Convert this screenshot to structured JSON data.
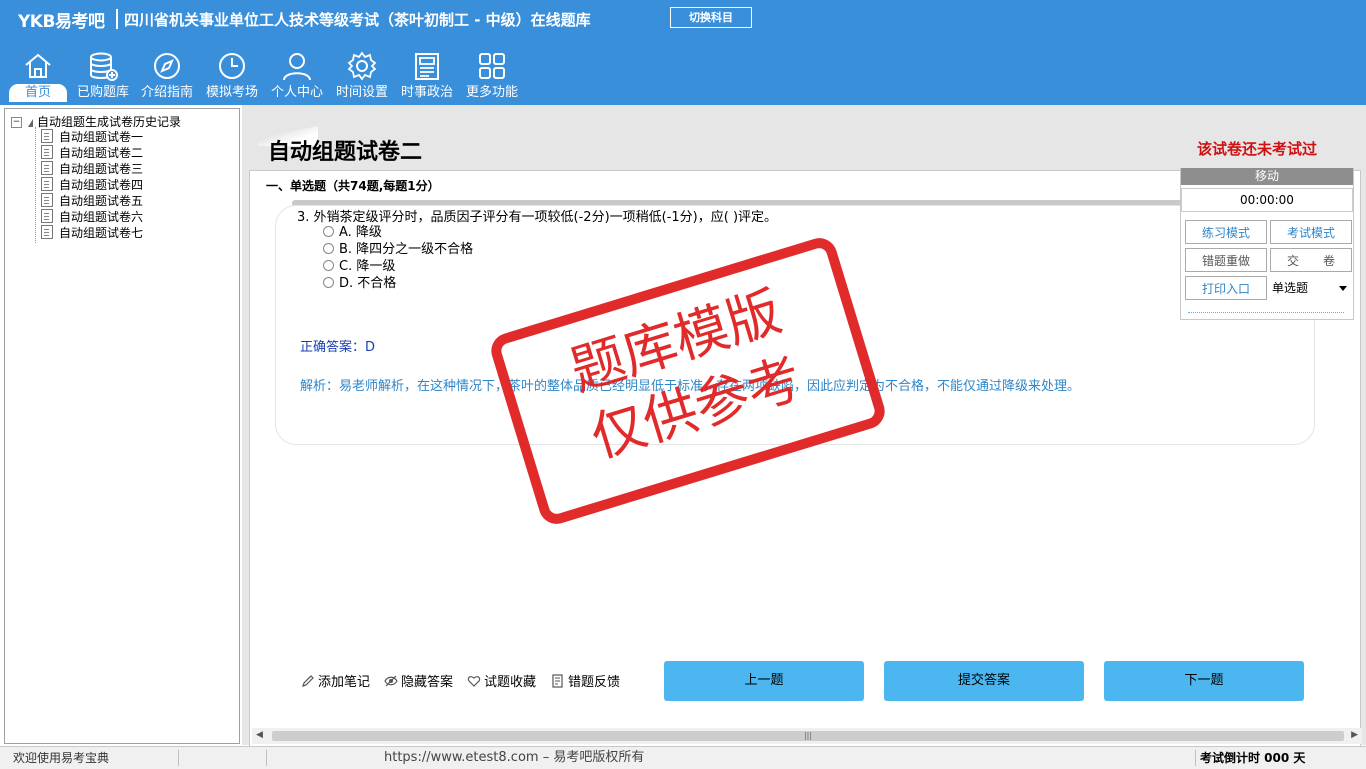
{
  "header": {
    "logo": "YKB易考吧",
    "title": "四川省机关事业单位工人技术等级考试（茶叶初制工 - 中级）在线题库",
    "switch_label": "切换科目",
    "nav": [
      {
        "label": "首页",
        "icon": "home-icon"
      },
      {
        "label": "已购题库",
        "icon": "database-icon"
      },
      {
        "label": "介绍指南",
        "icon": "compass-icon"
      },
      {
        "label": "模拟考场",
        "icon": "clock-icon"
      },
      {
        "label": "个人中心",
        "icon": "user-icon"
      },
      {
        "label": "时间设置",
        "icon": "gear-icon"
      },
      {
        "label": "时事政治",
        "icon": "news-icon"
      },
      {
        "label": "更多功能",
        "icon": "grid-icon"
      }
    ]
  },
  "tree": {
    "root": "自动组题生成试卷历史记录",
    "items": [
      "自动组题试卷一",
      "自动组题试卷二",
      "自动组题试卷三",
      "自动组题试卷四",
      "自动组题试卷五",
      "自动组题试卷六",
      "自动组题试卷七"
    ]
  },
  "main": {
    "doc_title": "自动组题试卷二",
    "exam_status": "该试卷还未考试过",
    "section_title": "一、单选题（共74题,每题1分）",
    "question": "3. 外销茶定级评分时，品质因子评分有一项较低(-2分)一项稍低(-1分)，应(  )评定。",
    "options": [
      "A. 降级",
      "B. 降四分之一级不合格",
      "C. 降一级",
      "D. 不合格"
    ],
    "answer": "正确答案：D",
    "analysis": "解析：易老师解析，在这种情况下，茶叶的整体品质已经明显低于标准，存在两项缺陷，因此应判定为不合格，不能仅通过降级来处理。",
    "stamp_line1": "题库模版",
    "stamp_line2": "仅供参考",
    "tools": [
      "添加笔记",
      "隐藏答案",
      "试题收藏",
      "错题反馈"
    ],
    "buttons": {
      "prev": "上一题",
      "submit": "提交答案",
      "next": "下一题"
    }
  },
  "float_panel": {
    "move": "移动",
    "timer": "00:00:00",
    "practice_mode": "练习模式",
    "exam_mode": "考试模式",
    "redo_wrong": "错题重做",
    "hand_in": "交　　卷",
    "print_entry": "打印入口",
    "question_type": "单选题"
  },
  "statusbar": {
    "welcome": "欢迎使用易考宝典",
    "url": "https://www.etest8.com – 易考吧版权所有",
    "countdown": "考试倒计时 000 天"
  },
  "colors": {
    "header_bg": "#3a8fdb",
    "button_bg": "#4bb6f0",
    "status_red": "#d01010",
    "stamp_red": "#e02020"
  }
}
